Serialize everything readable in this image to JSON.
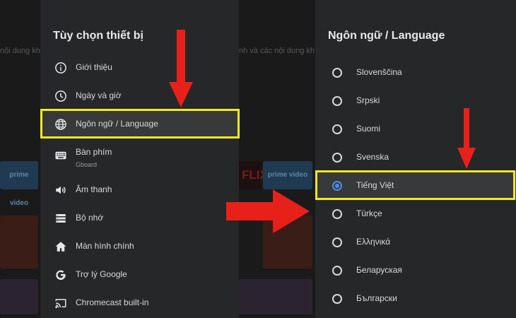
{
  "left_panel": {
    "title": "Tùy chọn thiết bị",
    "items": [
      {
        "label": "Giới thiệu",
        "icon": "info-icon"
      },
      {
        "label": "Ngày và giờ",
        "icon": "clock-icon"
      },
      {
        "label": "Ngôn ngữ / Language",
        "icon": "globe-icon",
        "selected": true
      },
      {
        "label": "Bàn phím",
        "sublabel": "Gboard",
        "icon": "keyboard-icon"
      },
      {
        "label": "Âm thanh",
        "icon": "speaker-icon"
      },
      {
        "label": "Bộ nhớ",
        "icon": "storage-icon"
      },
      {
        "label": "Màn hình chính",
        "icon": "home-icon"
      },
      {
        "label": "Trợ lý Google",
        "icon": "google-icon"
      },
      {
        "label": "Chromecast built-in",
        "icon": "cast-icon"
      }
    ]
  },
  "right_panel": {
    "title": "Ngôn ngữ / Language",
    "options": [
      {
        "label": "Slovenščina",
        "checked": false
      },
      {
        "label": "Srpski",
        "checked": false
      },
      {
        "label": "Suomi",
        "checked": false
      },
      {
        "label": "Svenska",
        "checked": false
      },
      {
        "label": "Tiếng Việt",
        "checked": true
      },
      {
        "label": "Türkçe",
        "checked": false
      },
      {
        "label": "Ελληνικά",
        "checked": false
      },
      {
        "label": "Беларуская",
        "checked": false
      },
      {
        "label": "Български",
        "checked": false
      }
    ]
  },
  "background": {
    "text_left": "nội dung kh",
    "text_right": "nh và các nội dung kh",
    "prime_label": "prime video",
    "netflix_label": "FLIX"
  },
  "colors": {
    "highlight": "#f3ea1c",
    "arrow": "#e8201a",
    "radio_selected": "#4a8ee6"
  }
}
